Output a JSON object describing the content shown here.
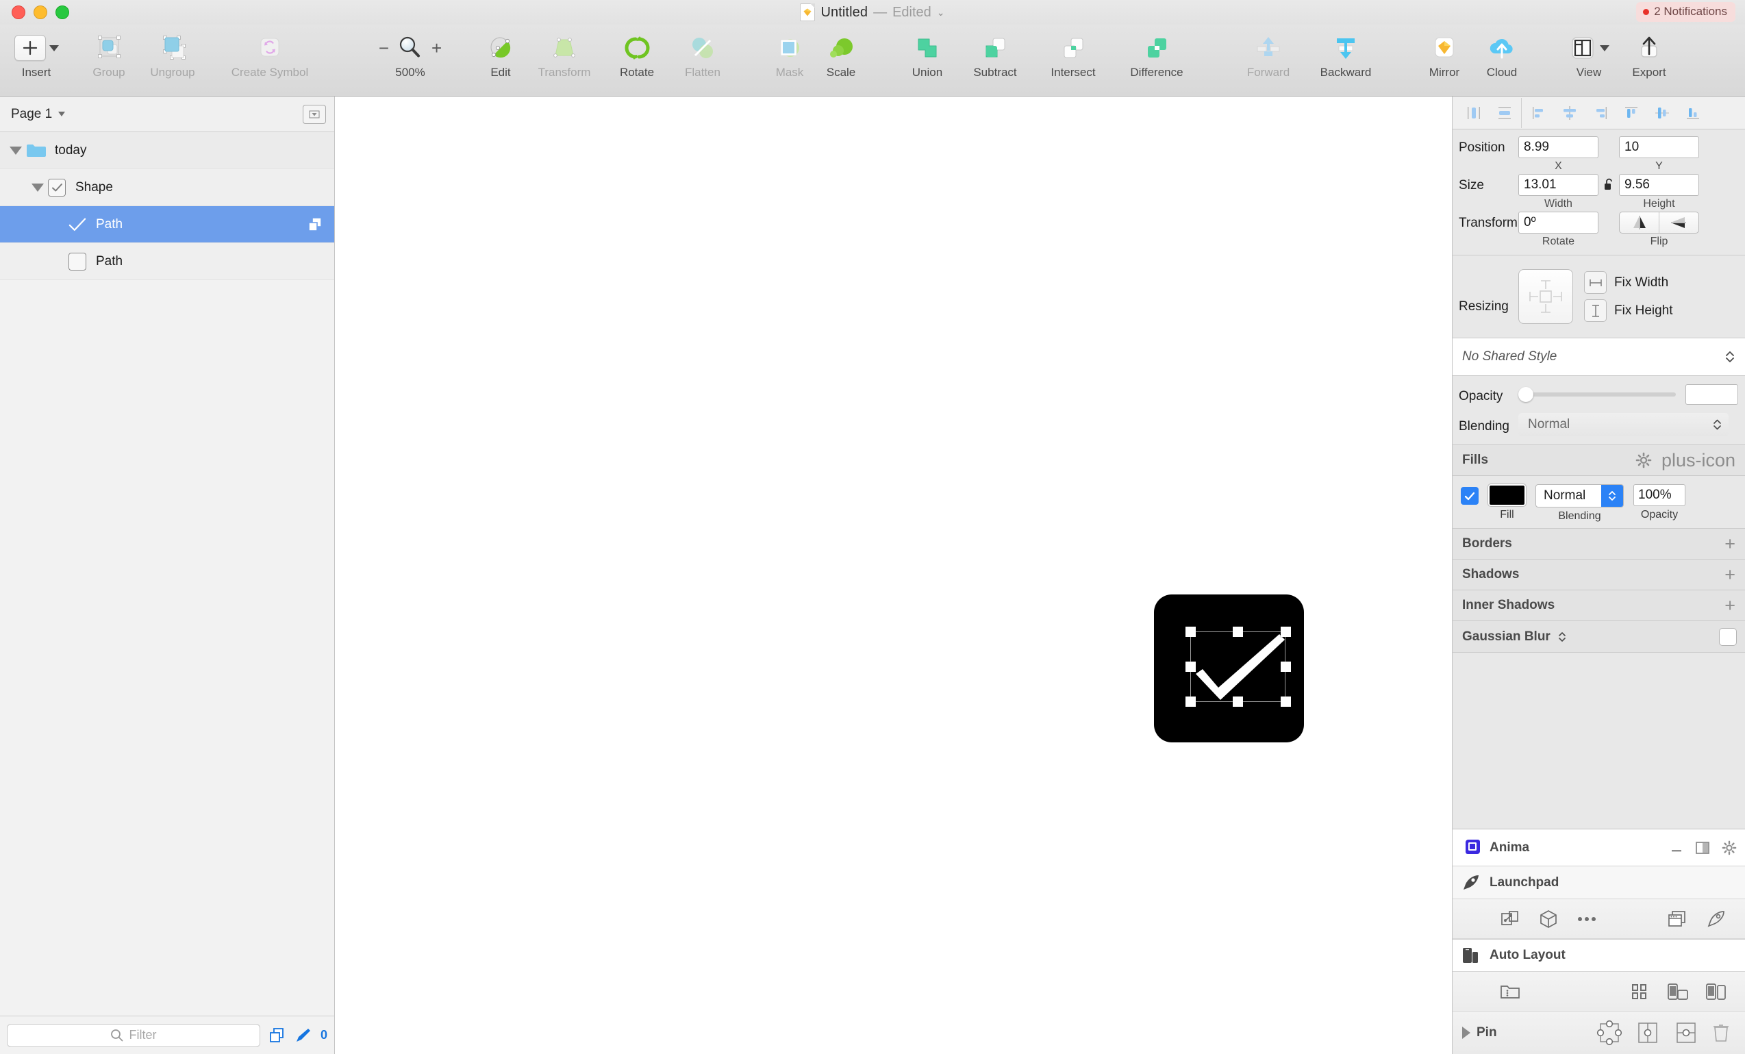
{
  "window": {
    "title": "Untitled",
    "separator": "—",
    "state": "Edited",
    "notifications_label": "2 Notifications",
    "accent_blue": "#6d9eeb",
    "selection_blue": "#2b82f6",
    "traffic_lights": [
      "close-red",
      "minimize-yellow",
      "maximize-green"
    ]
  },
  "toolbar": {
    "insert": {
      "label": "Insert",
      "icon": "plus-icon",
      "enabled": true
    },
    "group": {
      "label": "Group",
      "icon": "group-icon",
      "enabled": false
    },
    "ungroup": {
      "label": "Ungroup",
      "icon": "ungroup-icon",
      "enabled": false
    },
    "create_symbol": {
      "label": "Create Symbol",
      "icon": "symbol-icon",
      "enabled": false
    },
    "zoom": {
      "minus": "−",
      "plus": "+",
      "level": "500%",
      "icon": "magnifier-icon"
    },
    "edit": {
      "label": "Edit",
      "icon": "edit-vector-icon",
      "enabled": true
    },
    "transform": {
      "label": "Transform",
      "icon": "transform-icon",
      "enabled": false
    },
    "rotate": {
      "label": "Rotate",
      "icon": "rotate-icon",
      "enabled": true
    },
    "flatten": {
      "label": "Flatten",
      "icon": "flatten-icon",
      "enabled": false
    },
    "mask": {
      "label": "Mask",
      "icon": "mask-icon",
      "enabled": false
    },
    "scale": {
      "label": "Scale",
      "icon": "scale-icon",
      "enabled": true
    },
    "union": {
      "label": "Union",
      "icon": "union-icon",
      "enabled": true
    },
    "subtract": {
      "label": "Subtract",
      "icon": "subtract-icon",
      "enabled": true
    },
    "intersect": {
      "label": "Intersect",
      "icon": "intersect-icon",
      "enabled": true
    },
    "difference": {
      "label": "Difference",
      "icon": "difference-icon",
      "enabled": true
    },
    "forward": {
      "label": "Forward",
      "icon": "move-forward-icon",
      "enabled": false
    },
    "backward": {
      "label": "Backward",
      "icon": "move-backward-icon",
      "enabled": true
    },
    "mirror": {
      "label": "Mirror",
      "icon": "mirror-icon",
      "enabled": true
    },
    "cloud": {
      "label": "Cloud",
      "icon": "cloud-upload-icon",
      "enabled": true
    },
    "view": {
      "label": "View",
      "icon": "view-layout-icon",
      "enabled": true
    },
    "export": {
      "label": "Export",
      "icon": "export-arrow-icon",
      "enabled": true
    }
  },
  "sidebar": {
    "page_selector": {
      "label": "Page 1",
      "icon": "chevron-down-icon"
    },
    "page_options_icon": "page-options-icon",
    "layers": [
      {
        "name": "today",
        "level": 0,
        "type": "folder",
        "expanded": true,
        "selected": false,
        "visible": true,
        "has_checkbox": false
      },
      {
        "name": "Shape",
        "level": 1,
        "type": "group",
        "expanded": true,
        "selected": false,
        "visible": true,
        "has_checkbox": true
      },
      {
        "name": "Path",
        "level": 2,
        "type": "path",
        "expanded": false,
        "selected": true,
        "visible": true,
        "has_checkbox": true
      },
      {
        "name": "Path",
        "level": 2,
        "type": "path",
        "expanded": false,
        "selected": false,
        "visible": false,
        "has_checkbox": true
      }
    ],
    "filter": {
      "placeholder": "Filter",
      "value": "",
      "icon": "search-icon"
    },
    "footer": {
      "duplicate_icon": "duplicate-icon",
      "pen_icon": "pen-icon",
      "count": "0"
    }
  },
  "canvas": {
    "shape_fill": "#000000",
    "selection_handles": 8,
    "shape_name": "checkmark-artboard"
  },
  "inspector": {
    "align_buttons": [
      {
        "name": "distribute-horizontally",
        "icon": "distribute-h-icon"
      },
      {
        "name": "distribute-vertically",
        "icon": "distribute-v-icon"
      },
      {
        "name": "align-left",
        "icon": "align-left-icon"
      },
      {
        "name": "align-horizontal-center",
        "icon": "align-hcenter-icon"
      },
      {
        "name": "align-right",
        "icon": "align-right-icon"
      },
      {
        "name": "align-top",
        "icon": "align-top-icon"
      },
      {
        "name": "align-vertical-center",
        "icon": "align-vcenter-icon"
      },
      {
        "name": "align-bottom",
        "icon": "align-bottom-icon"
      }
    ],
    "position": {
      "label": "Position",
      "x": "8.99",
      "x_sub": "X",
      "y": "10",
      "y_sub": "Y"
    },
    "size": {
      "label": "Size",
      "width": "13.01",
      "width_sub": "Width",
      "height": "9.56",
      "height_sub": "Height",
      "lock_icon": "unlocked-padlock-icon",
      "locked": false
    },
    "transform": {
      "label": "Transform",
      "rotate": "0º",
      "rotate_sub": "Rotate",
      "flip_sub": "Flip",
      "flip_h_icon": "flip-horizontal-icon",
      "flip_v_icon": "flip-vertical-icon"
    },
    "resizing": {
      "label": "Resizing",
      "pad_icon": "resize-pad-icon",
      "fix_width": "Fix Width",
      "fix_height": "Fix Height",
      "fix_width_icon": "fix-width-icon",
      "fix_height_icon": "fix-height-icon"
    },
    "shared_style": {
      "value": "No Shared Style",
      "icon": "up-down-chevron-icon"
    },
    "opacity": {
      "label": "Opacity",
      "value": "",
      "slider_percent": 0
    },
    "blending": {
      "label": "Blending",
      "value": "Normal",
      "icon": "up-down-chevron-icon"
    },
    "fills": {
      "title": "Fills",
      "gear_icon": "gear-icon",
      "add_icon": "plus-icon",
      "row": {
        "enabled": true,
        "color": "#000000",
        "fill_sub": "Fill",
        "blending_value": "Normal",
        "blending_sub": "Blending",
        "opacity_value": "100%",
        "opacity_sub": "Opacity",
        "stepper_icon": "stepper-up-down-icon"
      }
    },
    "borders": {
      "title": "Borders",
      "add_icon": "plus-icon"
    },
    "shadows": {
      "title": "Shadows",
      "add_icon": "plus-icon"
    },
    "inner_shadows": {
      "title": "Inner Shadows",
      "add_icon": "plus-icon"
    },
    "gaussian_blur": {
      "title": "Gaussian Blur",
      "icon": "up-down-chevron-icon",
      "enabled": false
    }
  },
  "plugins": {
    "anima": {
      "title": "Anima",
      "logo_icon": "anima-logo-icon",
      "minimize_icon": "minimize-icon",
      "panel_icon": "panel-toggle-icon",
      "settings_icon": "gear-icon"
    },
    "launchpad": {
      "title": "Launchpad",
      "icon": "rocket-icon",
      "tools": [
        {
          "name": "link-export-icon"
        },
        {
          "name": "cube-icon"
        },
        {
          "name": "ellipsis-icon"
        },
        {
          "name": "browser-windows-icon"
        },
        {
          "name": "rocket-outline-icon"
        }
      ]
    },
    "auto_layout": {
      "title": "Auto Layout",
      "icon": "devices-icon",
      "tools": [
        {
          "name": "stack-folder-icon"
        },
        {
          "name": "grid-icon"
        },
        {
          "name": "phone-landscape-icon"
        },
        {
          "name": "phone-tablet-icon"
        }
      ],
      "pin": {
        "label": "Pin",
        "disclosure_icon": "triangle-right-icon",
        "tools": [
          {
            "name": "pin-edges-icon"
          },
          {
            "name": "pin-horizontal-center-icon"
          },
          {
            "name": "pin-vertical-center-icon"
          },
          {
            "name": "trash-icon"
          }
        ]
      }
    }
  }
}
